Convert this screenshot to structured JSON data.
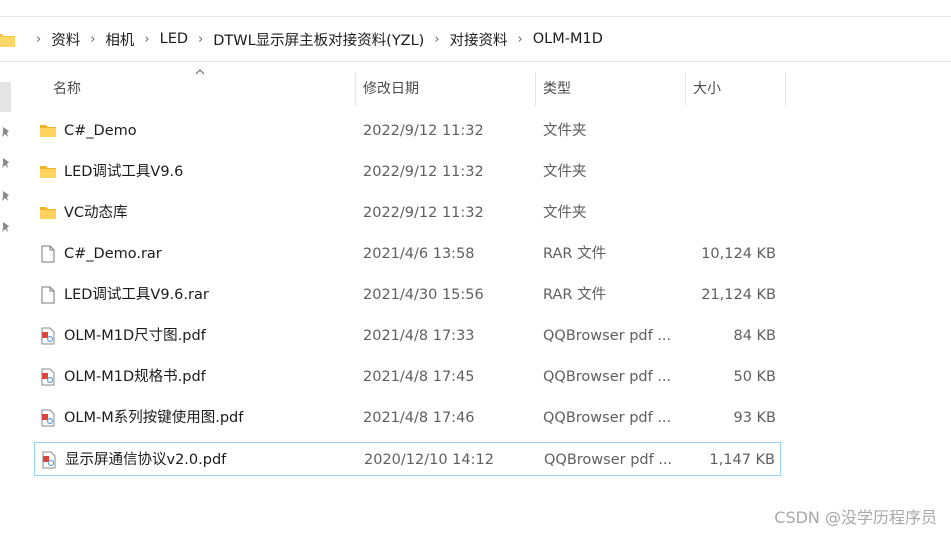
{
  "breadcrumb": [
    "资料",
    "相机",
    "LED",
    "DTWL显示屏主板对接资料(YZL)",
    "对接资料",
    "OLM-M1D"
  ],
  "breadcrumb_separator": "›",
  "columns": {
    "name": "名称",
    "date": "修改日期",
    "type": "类型",
    "size": "大小"
  },
  "files": [
    {
      "name": "C#_Demo",
      "date": "2022/9/12 11:32",
      "type": "文件夹",
      "size": "",
      "icon": "folder-icon"
    },
    {
      "name": "LED调试工具V9.6",
      "date": "2022/9/12 11:32",
      "type": "文件夹",
      "size": "",
      "icon": "folder-icon"
    },
    {
      "name": "VC动态库",
      "date": "2022/9/12 11:32",
      "type": "文件夹",
      "size": "",
      "icon": "folder-icon"
    },
    {
      "name": "C#_Demo.rar",
      "date": "2021/4/6 13:58",
      "type": "RAR 文件",
      "size": "10,124 KB",
      "icon": "file-icon"
    },
    {
      "name": "LED调试工具V9.6.rar",
      "date": "2021/4/30 15:56",
      "type": "RAR 文件",
      "size": "21,124 KB",
      "icon": "file-icon"
    },
    {
      "name": "OLM-M1D尺寸图.pdf",
      "date": "2021/4/8 17:33",
      "type": "QQBrowser pdf ...",
      "size": "84 KB",
      "icon": "pdf-icon"
    },
    {
      "name": "OLM-M1D规格书.pdf",
      "date": "2021/4/8 17:45",
      "type": "QQBrowser pdf ...",
      "size": "50 KB",
      "icon": "pdf-icon"
    },
    {
      "name": "OLM-M系列按键使用图.pdf",
      "date": "2021/4/8 17:46",
      "type": "QQBrowser pdf ...",
      "size": "93 KB",
      "icon": "pdf-icon"
    },
    {
      "name": "显示屏通信协议v2.0.pdf",
      "date": "2020/12/10 14:12",
      "type": "QQBrowser pdf ...",
      "size": "1,147 KB",
      "icon": "pdf-icon",
      "selected": true
    }
  ],
  "watermark": "CSDN @没学历程序员",
  "colors": {
    "folder": "#f4c54a",
    "selection_border": "#99d1ff",
    "secondary_text": "#5f5f5f"
  }
}
